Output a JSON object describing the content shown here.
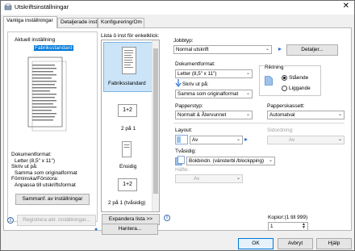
{
  "window": {
    "title": "Utskriftsinställningar",
    "close_glyph": "✕"
  },
  "tabs": [
    {
      "label": "Vanliga inställningar",
      "active": true
    },
    {
      "label": "Detaljerade inst"
    },
    {
      "label": "Konfigurering/Om"
    }
  ],
  "current": {
    "heading": "Aktuell inställning",
    "preset": "Fabriksstandard",
    "summary": [
      "Dokumentformat:",
      "Letter (8,5\" x 11\")",
      "Skriv ut på:",
      "Samma som originalformat",
      "Förminska/Förstora:",
      "Anpassa till utskriftsformat"
    ],
    "summary_button": "Sammanf. av inställningar",
    "register_button": "Registrera akt. inställningar..."
  },
  "one_click": {
    "heading": "Lista ö inst för enkelklick:",
    "items": [
      {
        "label": "Fabriksstandard",
        "selected": true
      },
      {
        "label": "2 på 1",
        "badge": "1+2"
      },
      {
        "label": "Ensidig"
      },
      {
        "label": "2 på 1 (tvåsidig)",
        "badge": "1+2"
      }
    ],
    "expand_button": "Expandera lista >>",
    "manage_button": "Hantera..."
  },
  "job": {
    "label": "Jobbtyp:",
    "value": "Normal utskrift",
    "details_button": "Detaljer..."
  },
  "docsize": {
    "label": "Dokumentformat:",
    "value": "Letter (8,5\" x 11\")"
  },
  "print_on": {
    "label": "Skriv ut på:",
    "value": "Samma som originalformat"
  },
  "orientation": {
    "label": "Riktning",
    "options": [
      {
        "label": "Stående",
        "checked": true
      },
      {
        "label": "Liggande",
        "checked": false
      }
    ]
  },
  "paper_type": {
    "label": "Papperstyp:",
    "value": "Normalt & Återvunnet"
  },
  "paper_tray": {
    "label": "Papperskassett:",
    "value": "Automatval"
  },
  "layout": {
    "label": "Layout:",
    "value": "Av"
  },
  "layout_order": {
    "label": "Sidordning:",
    "value": "Av"
  },
  "duplex": {
    "label": "Tvåsidig:",
    "value": "Bokbindn. (vänsterbl./blockpping)"
  },
  "staple": {
    "label": "Häfte:",
    "value": "Av"
  },
  "copies": {
    "label": "Kopior:(1 till 999)",
    "value": "1"
  },
  "footer": {
    "ok": "OK",
    "cancel": "Avbryt",
    "help": "Hjälp"
  },
  "icons": {
    "info": "i",
    "arrow_down": "⌄",
    "arrow_right": "▸"
  }
}
